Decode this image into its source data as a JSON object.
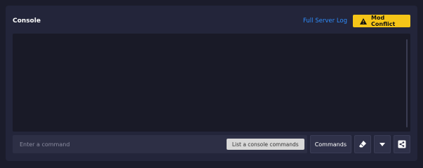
{
  "console": {
    "title": "Console",
    "full_server_log_label": "Full Server Log",
    "mod_conflict_label": "Mod Conflict",
    "input": {
      "placeholder": "Enter a command",
      "value": ""
    },
    "list_commands_label": "List a console commands",
    "commands_button_label": "Commands",
    "icons": {
      "warning": "warning-icon",
      "eraser": "eraser-icon",
      "dropdown": "chevron-down-icon",
      "share": "share-icon"
    },
    "colors": {
      "background": "#1b1c2b",
      "panel": "#23253a",
      "output": "#191a27",
      "accent_link": "#2f8dfc",
      "warning_button": "#f5c518"
    }
  }
}
